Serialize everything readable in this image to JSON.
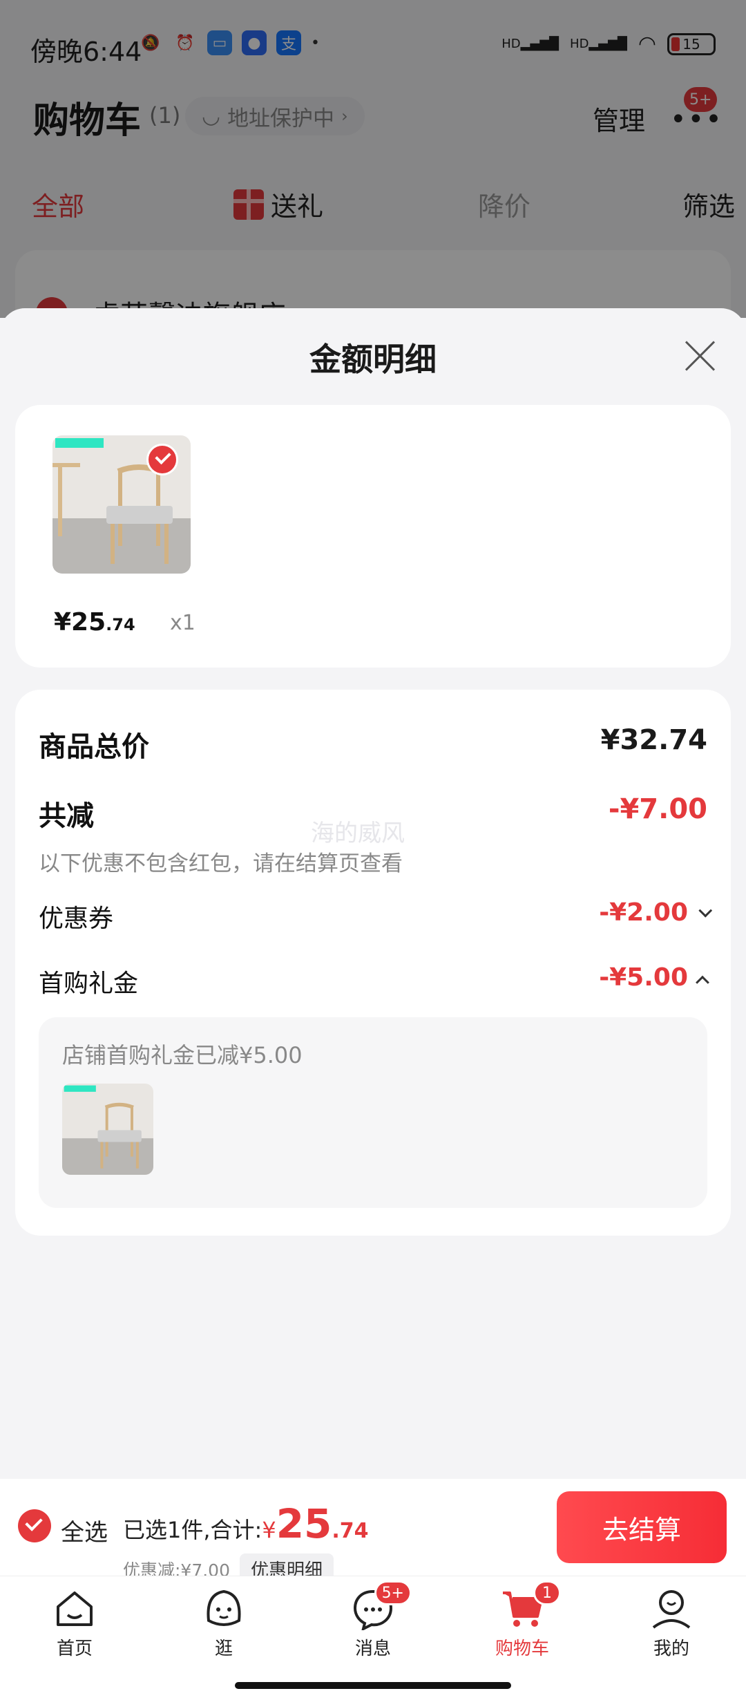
{
  "status_bar": {
    "time": "傍晚6:44",
    "battery": "15"
  },
  "header": {
    "title": "购物车",
    "count": "(1)",
    "address_pill": "地址保护中",
    "manage": "管理",
    "more_badge": "5+"
  },
  "tabs": {
    "all": "全部",
    "gift": "送礼",
    "price_drop": "降价",
    "filter": "筛选"
  },
  "shop": {
    "name": "虎萌馨迪旗舰店"
  },
  "sheet": {
    "title": "金额明细",
    "product": {
      "price_main": "¥25",
      "price_dec": ".74",
      "qty": "x1"
    },
    "total_label": "商品总价",
    "total_value": "¥32.74",
    "reduce_label": "共减",
    "reduce_value": "-¥7.00",
    "reduce_note": "以下优惠不包含红包，请在结算页查看",
    "watermark": "海的威风",
    "coupon_label": "优惠券",
    "coupon_value": "-¥2.00",
    "first_gift_label": "首购礼金",
    "first_gift_value": "-¥5.00",
    "gift_note": "店铺首购礼金已减¥5.00"
  },
  "checkout": {
    "select_all": "全选",
    "selected_text": "已选1件,合计:",
    "yen": "¥",
    "total_int": "25",
    "total_dec": ".74",
    "discount_text": "优惠减:¥7.00",
    "detail_button": "优惠明细",
    "checkout_button": "去结算"
  },
  "tabbar": {
    "home": "首页",
    "browse": "逛",
    "messages": "消息",
    "messages_badge": "5+",
    "cart": "购物车",
    "cart_badge": "1",
    "mine": "我的"
  },
  "colors": {
    "accent": "#e4393c"
  }
}
